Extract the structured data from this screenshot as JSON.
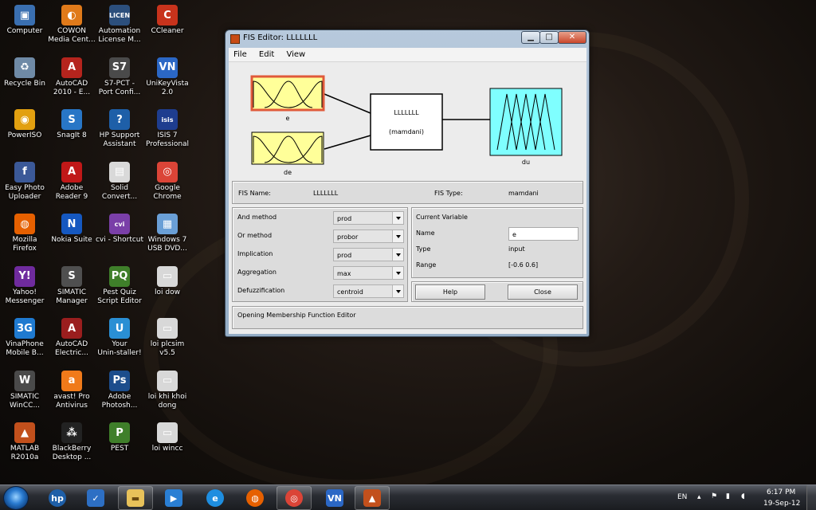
{
  "desktop": {
    "icons": [
      {
        "label": "Computer",
        "color": "#3a6fb0",
        "glyph": "▣"
      },
      {
        "label": "COWON\nMedia Cent...",
        "color": "#e07a1a",
        "glyph": "◐"
      },
      {
        "label": "Automation\nLicense M...",
        "color": "#2c4f7c",
        "glyph": "LICEN"
      },
      {
        "label": "CCleaner",
        "color": "#c8331c",
        "glyph": "C"
      },
      {
        "label": "Recycle Bin",
        "color": "#6f8aa6",
        "glyph": "♻"
      },
      {
        "label": "AutoCAD\n2010 - E...",
        "color": "#b5241d",
        "glyph": "A"
      },
      {
        "label": "S7-PCT -\nPort Confi...",
        "color": "#4a4a4a",
        "glyph": "S7"
      },
      {
        "label": "UniKeyVista\n2.0",
        "color": "#2b67c5",
        "glyph": "VN"
      },
      {
        "label": "PowerISO",
        "color": "#e2a010",
        "glyph": "◉"
      },
      {
        "label": "SnagIt 8",
        "color": "#2876c6",
        "glyph": "S"
      },
      {
        "label": "HP Support\nAssistant",
        "color": "#1e5fa8",
        "glyph": "?"
      },
      {
        "label": "ISIS 7\nProfessional",
        "color": "#1e3d8f",
        "glyph": "isis"
      },
      {
        "label": "Easy Photo\nUploader",
        "color": "#3b5998",
        "glyph": "f"
      },
      {
        "label": "Adobe\nReader 9",
        "color": "#c01818",
        "glyph": "A"
      },
      {
        "label": "Solid\nConvert...",
        "color": "#d9d9d9",
        "glyph": "▤"
      },
      {
        "label": "Google\nChrome",
        "color": "#db4437",
        "glyph": "◎"
      },
      {
        "label": "Mozilla\nFirefox",
        "color": "#e66000",
        "glyph": "◍"
      },
      {
        "label": "Nokia Suite",
        "color": "#1558c0",
        "glyph": "N"
      },
      {
        "label": "cvi - Shortcut",
        "color": "#7a3fa8",
        "glyph": "cvi"
      },
      {
        "label": "Windows 7\nUSB DVD...",
        "color": "#6a9fd6",
        "glyph": "▦"
      },
      {
        "label": "Yahoo!\nMessenger",
        "color": "#6f2b9e",
        "glyph": "Y!"
      },
      {
        "label": "SIMATIC\nManager",
        "color": "#4f4f4f",
        "glyph": "S"
      },
      {
        "label": "Pest Quiz\nScript Editor",
        "color": "#3f7f2a",
        "glyph": "PQ"
      },
      {
        "label": "loi dow",
        "color": "#d8d8d8",
        "glyph": "▭"
      },
      {
        "label": "VinaPhone\nMobile B...",
        "color": "#1f7ad0",
        "glyph": "3G"
      },
      {
        "label": "AutoCAD\nElectric...",
        "color": "#9a1e1e",
        "glyph": "A"
      },
      {
        "label": "Your\nUnin-staller!",
        "color": "#2a8fd4",
        "glyph": "U"
      },
      {
        "label": "loi plcsim\nv5.5",
        "color": "#d8d8d8",
        "glyph": "▭"
      },
      {
        "label": "SIMATIC\nWinCC...",
        "color": "#4a4a4a",
        "glyph": "W"
      },
      {
        "label": "avast! Pro\nAntivirus",
        "color": "#f07a1a",
        "glyph": "a"
      },
      {
        "label": "Adobe\nPhotosh...",
        "color": "#1c4d8c",
        "glyph": "Ps"
      },
      {
        "label": "loi khi khoi\ndong",
        "color": "#d8d8d8",
        "glyph": "▭"
      },
      {
        "label": "MATLAB\nR2010a",
        "color": "#c2501c",
        "glyph": "▲"
      },
      {
        "label": "BlackBerry\nDesktop ...",
        "color": "#222222",
        "glyph": "⁂"
      },
      {
        "label": "PEST",
        "color": "#3f7f2a",
        "glyph": "P"
      },
      {
        "label": "loi wincc",
        "color": "#d8d8d8",
        "glyph": "▭"
      }
    ]
  },
  "window": {
    "title": "FIS Editor: LLLLLLL",
    "menu": {
      "file": "File",
      "edit": "Edit",
      "view": "View"
    },
    "diagram": {
      "input1": "e",
      "input2": "de",
      "system_name": "LLLLLLL",
      "system_type": "(mamdani)",
      "output": "du",
      "input_color": "#ffff99",
      "output_color": "#7fffff",
      "selected_border": "#e05a3a"
    },
    "fis_name_label": "FIS Name:",
    "fis_name_value": "LLLLLLL",
    "fis_type_label": "FIS Type:",
    "fis_type_value": "mamdani",
    "methods": {
      "and_label": "And method",
      "and_value": "prod",
      "or_label": "Or method",
      "or_value": "probor",
      "impl_label": "Implication",
      "impl_value": "prod",
      "agg_label": "Aggregation",
      "agg_value": "max",
      "defuzz_label": "Defuzzification",
      "defuzz_value": "centroid"
    },
    "current_variable": {
      "heading": "Current Variable",
      "name_label": "Name",
      "name_value": "e",
      "type_label": "Type",
      "type_value": "input",
      "range_label": "Range",
      "range_value": "[-0.6 0.6]"
    },
    "help_button": "Help",
    "close_button": "Close",
    "status": "Opening Membership Function Editor"
  },
  "taskbar": {
    "language": "EN",
    "time": "6:17 PM",
    "date": "19-Sep-12"
  }
}
